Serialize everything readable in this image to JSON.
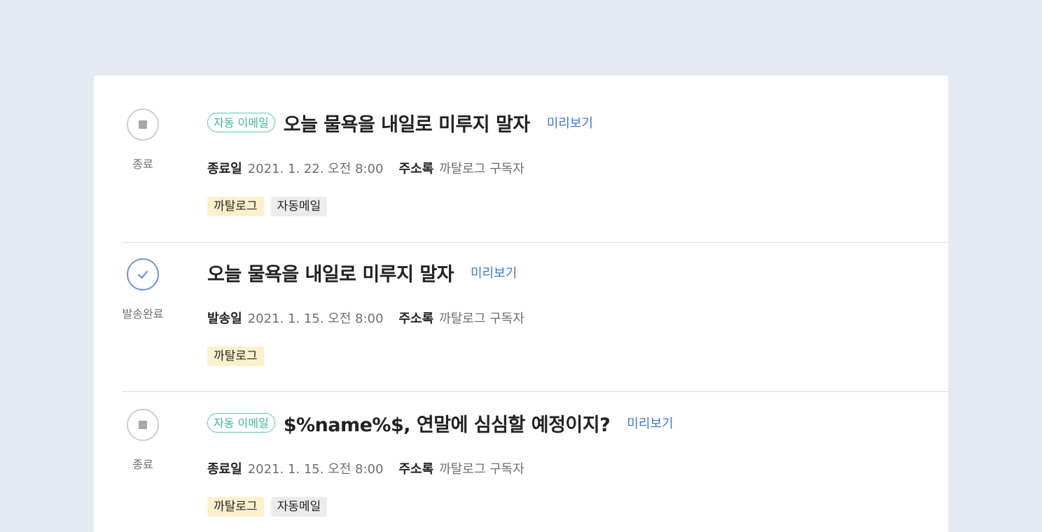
{
  "campaigns": [
    {
      "status": "stopped",
      "status_label": "종료",
      "auto_badge": "자동 이메일",
      "title": "오늘 물욕을 내일로 미루지 말자",
      "preview_label": "미리보기",
      "date_key": "종료일",
      "date_value": "2021. 1. 22. 오전 8:00",
      "list_key": "주소록",
      "list_value": "까탈로그 구독자",
      "tags": [
        "까탈로그",
        "자동메일"
      ]
    },
    {
      "status": "sent",
      "status_label": "발송완료",
      "auto_badge": "",
      "title": "오늘 물욕을 내일로 미루지 말자",
      "preview_label": "미리보기",
      "date_key": "발송일",
      "date_value": "2021. 1. 15. 오전 8:00",
      "list_key": "주소록",
      "list_value": "까탈로그 구독자",
      "tags": [
        "까탈로그"
      ]
    },
    {
      "status": "stopped",
      "status_label": "종료",
      "auto_badge": "자동 이메일",
      "title": "$%name%$, 연말에 심심할 예정이지?",
      "preview_label": "미리보기",
      "date_key": "종료일",
      "date_value": "2021. 1. 15. 오전 8:00",
      "list_key": "주소록",
      "list_value": "까탈로그 구독자",
      "tags": [
        "까탈로그",
        "자동메일"
      ]
    }
  ],
  "colors": {
    "page_background": "#e5eaf2",
    "card_background": "#ffffff",
    "auto_badge": "#3fb79d",
    "preview_link": "#3d78d8",
    "sent_check": "#6d95de",
    "tag_yellow": "#fdf1cc",
    "tag_gray": "#ececec"
  },
  "icons": {
    "stopped": "stop-square-icon",
    "sent": "check-icon"
  }
}
